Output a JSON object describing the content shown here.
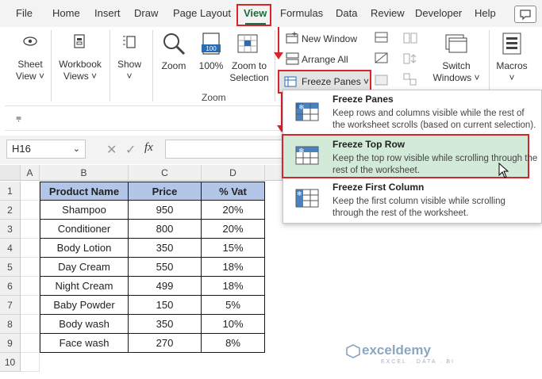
{
  "menu": {
    "items": [
      "File",
      "Home",
      "Insert",
      "Draw",
      "Page Layout",
      "View",
      "Formulas",
      "Data",
      "Review",
      "Developer",
      "Help"
    ],
    "active": "View"
  },
  "ribbon": {
    "sheet_view": [
      "Sheet",
      "View ˅"
    ],
    "workbook_views": [
      "Workbook",
      "Views ˅"
    ],
    "show": [
      "Show",
      "˅"
    ],
    "zoom": "Zoom",
    "zoom_100": "100%",
    "zoom_to_selection": [
      "Zoom to",
      "Selection"
    ],
    "zoom_icon_value": "100",
    "group_zoom": "Zoom",
    "new_window": "New Window",
    "arrange_all": "Arrange All",
    "freeze_panes": "Freeze Panes ˅",
    "switch_windows": [
      "Switch",
      "Windows ˅"
    ],
    "macros": [
      "Macros",
      "˅"
    ],
    "strip_glyph": "⩦"
  },
  "formula_bar": {
    "name_box": "H16",
    "fx": "fx"
  },
  "columns": [
    "A",
    "B",
    "C",
    "D"
  ],
  "rows": [
    "1",
    "2",
    "3",
    "4",
    "5",
    "6",
    "7",
    "8",
    "9",
    "10"
  ],
  "table": {
    "headers": [
      "Product Name",
      "Price",
      "% Vat"
    ],
    "rows": [
      [
        "Shampoo",
        "950",
        "20%"
      ],
      [
        "Conditioner",
        "800",
        "20%"
      ],
      [
        "Body Lotion",
        "350",
        "15%"
      ],
      [
        "Day Cream",
        "550",
        "18%"
      ],
      [
        "Night Cream",
        "499",
        "18%"
      ],
      [
        "Baby Powder",
        "150",
        "5%"
      ],
      [
        "Body wash",
        "350",
        "10%"
      ],
      [
        "Face wash",
        "270",
        "8%"
      ]
    ]
  },
  "dropdown": {
    "items": [
      {
        "title": "Freeze Panes",
        "desc": "Keep rows and columns visible while the rest of the worksheet scrolls (based on current selection)."
      },
      {
        "title": "Freeze Top Row",
        "desc": "Keep the top row visible while scrolling through the rest of the worksheet."
      },
      {
        "title": "Freeze First Column",
        "desc": "Keep the first column visible while scrolling through the rest of the worksheet."
      }
    ]
  },
  "watermark": {
    "name": "exceldemy",
    "sub": "EXCEL · DATA · BI"
  },
  "colors": {
    "accent": "#1e6b3e",
    "highlight_box": "#d6262a",
    "header_fill": "#b4c6e7",
    "menu_highlight": "#d2ead8"
  }
}
